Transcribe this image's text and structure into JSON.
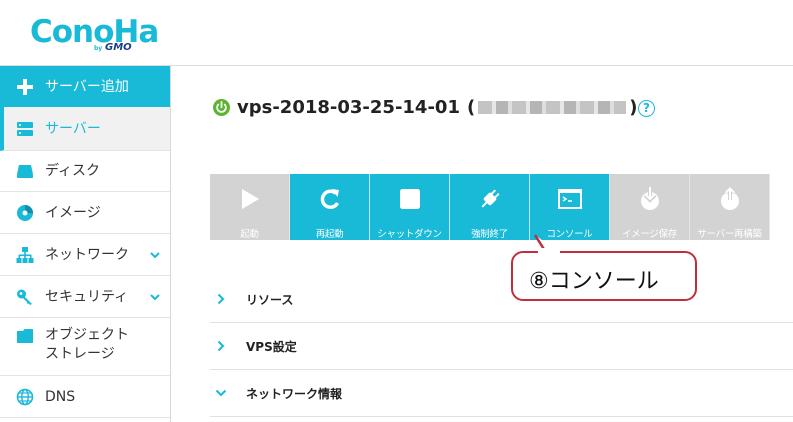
{
  "brand": {
    "name": "ConoHa",
    "by": "by",
    "gmo": "GMO",
    "color": "#19b9d8"
  },
  "sidebar": {
    "items": [
      {
        "label": "サーバー追加",
        "icon": "plus-icon",
        "state": "action"
      },
      {
        "label": "サーバー",
        "icon": "server-icon",
        "state": "selected"
      },
      {
        "label": "ディスク",
        "icon": "disk-icon"
      },
      {
        "label": "イメージ",
        "icon": "image-icon"
      },
      {
        "label": "ネットワーク",
        "icon": "network-icon",
        "expandable": true
      },
      {
        "label": "セキュリティ",
        "icon": "key-icon",
        "expandable": true
      },
      {
        "label": "オブジェクト\nストレージ",
        "label_line1": "オブジェクト",
        "label_line2": "ストレージ",
        "icon": "folder-icon"
      },
      {
        "label": "DNS",
        "icon": "globe-icon"
      }
    ]
  },
  "server": {
    "name": "vps-2018-03-25-14-01",
    "open_paren": "(",
    "close_paren": ")",
    "status": "running",
    "status_color": "#5cb531",
    "help": "?"
  },
  "toolbar": {
    "buttons": [
      {
        "label": "起動",
        "icon": "play-icon",
        "enabled": false
      },
      {
        "label": "再起動",
        "icon": "restart-icon",
        "enabled": true
      },
      {
        "label": "シャットダウン",
        "icon": "stop-icon",
        "enabled": true
      },
      {
        "label": "強制終了",
        "icon": "plug-icon",
        "enabled": true
      },
      {
        "label": "コンソール",
        "icon": "console-icon",
        "enabled": true
      },
      {
        "label": "イメージ保存",
        "icon": "save-image-icon",
        "enabled": false
      },
      {
        "label": "サーバー再構築",
        "icon": "rebuild-icon",
        "enabled": false
      }
    ]
  },
  "callout": {
    "text": "⑧コンソール",
    "color": "#c0303a"
  },
  "sections": [
    {
      "label": "リソース",
      "expanded": false
    },
    {
      "label": "VPS設定",
      "expanded": false
    },
    {
      "label": "ネットワーク情報",
      "expanded": true
    }
  ]
}
